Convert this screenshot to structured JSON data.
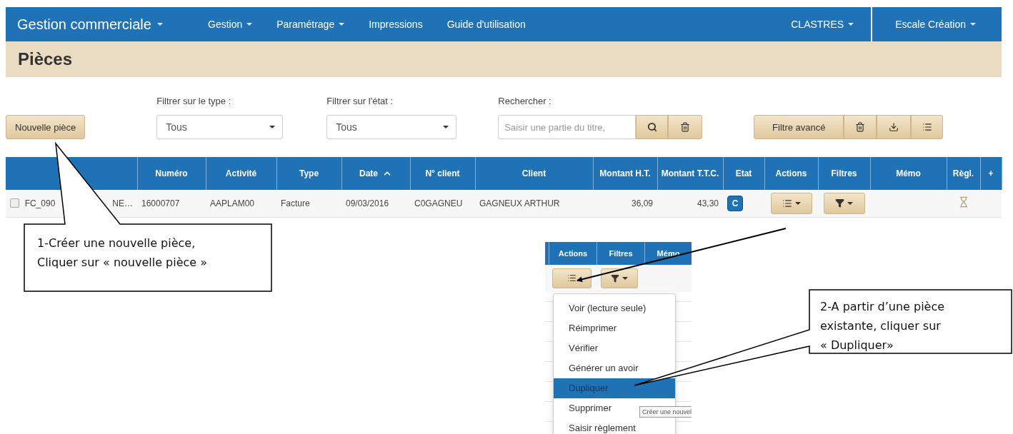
{
  "navbar": {
    "brand": {
      "label": "Gestion commerciale",
      "dropdown": true
    },
    "items": [
      {
        "label": "Gestion",
        "dropdown": true
      },
      {
        "label": "Paramétrage",
        "dropdown": true
      },
      {
        "label": "Impressions",
        "dropdown": false
      },
      {
        "label": "Guide d'utilisation",
        "dropdown": false
      }
    ],
    "right": [
      {
        "label": "CLASTRES",
        "dropdown": true
      },
      {
        "label": "Escale Création",
        "dropdown": true
      }
    ]
  },
  "page_title": "Pièces",
  "toolbar": {
    "new_button": "Nouvelle pièce",
    "type_filter": {
      "label": "Filtrer sur le type :",
      "value": "Tous"
    },
    "state_filter": {
      "label": "Filtrer sur l'état :",
      "value": "Tous"
    },
    "search": {
      "label": "Rechercher :",
      "placeholder": "Saisir une partie du titre,"
    },
    "advanced_filter": "Filtre avancé"
  },
  "table": {
    "columns": [
      {
        "label": "Numéro",
        "sorted": false
      },
      {
        "label": "Activité",
        "sorted": false
      },
      {
        "label": "Type",
        "sorted": false
      },
      {
        "label": "Date",
        "sorted": true
      },
      {
        "label": "N° client",
        "sorted": false
      },
      {
        "label": "Client",
        "sorted": false
      },
      {
        "label": "Montant H.T.",
        "sorted": false
      },
      {
        "label": "Montant T.T.C.",
        "sorted": false
      },
      {
        "label": "Etat",
        "sorted": false
      },
      {
        "label": "Actions",
        "sorted": false
      },
      {
        "label": "Filtres",
        "sorted": false
      },
      {
        "label": "Mémo",
        "sorted": false
      },
      {
        "label": "Règl.",
        "sorted": false
      },
      {
        "label": "+",
        "sorted": false
      }
    ],
    "rows": [
      {
        "checked": false,
        "piece_start": "FC_090",
        "piece_end": "NE…",
        "numero": "16000707",
        "activite": "AAPLAM00",
        "type": "Facture",
        "date": "09/03/2016",
        "no_client": "C0GAGNEU",
        "client": "GAGNEUX ARTHUR",
        "montant_ht": "36,09",
        "montant_ttc": "43,30",
        "etat": "C"
      }
    ]
  },
  "inset": {
    "columns": [
      {
        "label": "Actions"
      },
      {
        "label": "Filtres"
      },
      {
        "label": "Mémo"
      }
    ],
    "menu": [
      {
        "label": "Voir (lecture seule)",
        "selected": false
      },
      {
        "label": "Réimprimer",
        "selected": false
      },
      {
        "label": "Vérifier",
        "selected": false
      },
      {
        "label": "Générer un avoir",
        "selected": false
      },
      {
        "label": "Dupliquer",
        "selected": true
      },
      {
        "label": "Supprimer",
        "selected": false
      },
      {
        "label": "Saisir règlement",
        "selected": false
      }
    ],
    "tooltip": "Créer une nouvel"
  },
  "callouts": [
    {
      "lines": [
        "1-Créer une nouvelle pièce,",
        "Cliquer sur « nouvelle pièce »"
      ]
    },
    {
      "lines": [
        "2-A partir d’une pièce",
        "existante, cliquer sur",
        "« Dupliquer»"
      ]
    }
  ]
}
